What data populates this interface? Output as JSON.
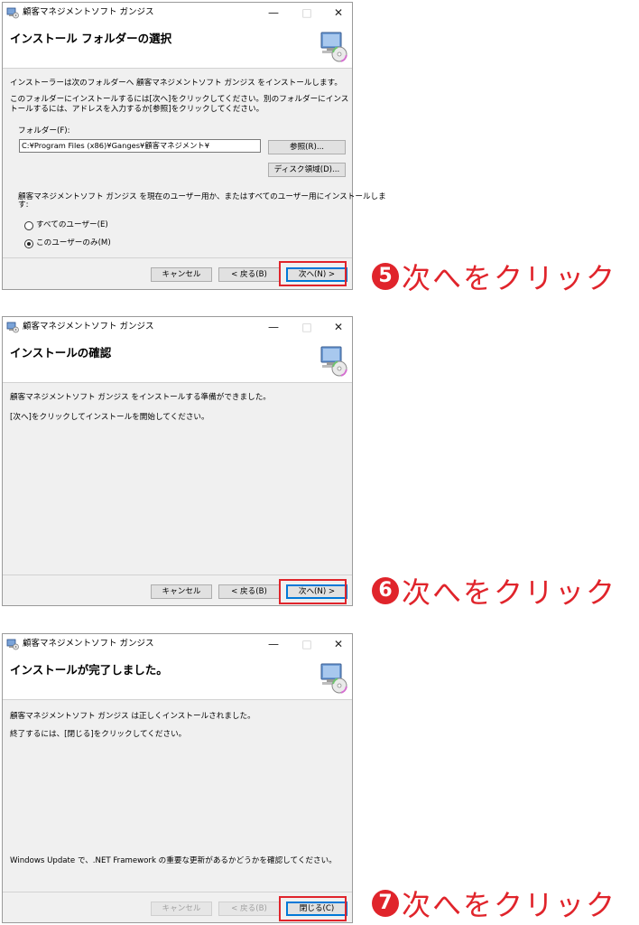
{
  "colors": {
    "accent_red": "#e0242b",
    "focus_blue": "#0078d7",
    "dialog_bg": "#f0f0f0"
  },
  "icons": {
    "app": "installer-app-icon",
    "header": "computer-cd-icon"
  },
  "window_title": "顧客マネジメントソフト ガンジス",
  "window_controls": {
    "minimize": "—",
    "maximize": "□",
    "close": "✕"
  },
  "dialog1": {
    "header_title": "インストール フォルダーの選択",
    "line1": "インストーラーは次のフォルダーへ 顧客マネジメントソフト ガンジス をインストールします。",
    "line2": "このフォルダーにインストールするには[次へ]をクリックしてください。別のフォルダーにインス",
    "line3": "トールするには、アドレスを入力するか[参照]をクリックしてください。",
    "folder_label": "フォルダー(F):",
    "folder_value": "C:¥Program Files (x86)¥Ganges¥顧客マネジメント¥",
    "browse_button": "参照(R)...",
    "disk_button": "ディスク領域(D)...",
    "users_line1": "顧客マネジメントソフト ガンジス を現在のユーザー用か、またはすべてのユーザー用にインストールしま",
    "users_line2": "す:",
    "radio_all": "すべてのユーザー(E)",
    "radio_me": "このユーザーのみ(M)",
    "selected_option": "このユーザーのみ(M)",
    "cancel_button": "キャンセル",
    "back_button": "< 戻る(B)",
    "next_button": "次へ(N) >"
  },
  "dialog2": {
    "header_title": "インストールの確認",
    "line1": "顧客マネジメントソフト ガンジス をインストールする準備ができました。",
    "line2": "[次へ]をクリックしてインストールを開始してください。",
    "cancel_button": "キャンセル",
    "back_button": "< 戻る(B)",
    "next_button": "次へ(N) >"
  },
  "dialog3": {
    "header_title": "インストールが完了しました。",
    "line1": "顧客マネジメントソフト ガンジス は正しくインストールされました。",
    "line2": "終了するには、[閉じる]をクリックしてください。",
    "update_note": "Windows Update で、.NET Framework の重要な更新があるかどうかを確認してください。",
    "cancel_button": "キャンセル",
    "back_button": "< 戻る(B)",
    "close_button": "閉じる(C)"
  },
  "annotations": [
    {
      "number": "5",
      "text": "次へをクリック"
    },
    {
      "number": "6",
      "text": "次へをクリック"
    },
    {
      "number": "7",
      "text": "次へをクリック"
    }
  ]
}
